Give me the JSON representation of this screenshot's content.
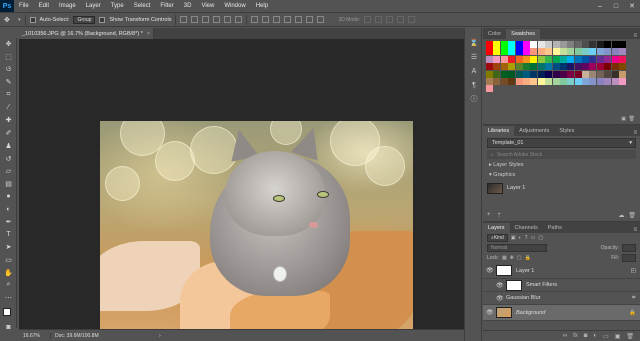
{
  "menubar": {
    "logo": "Ps",
    "items": [
      "File",
      "Edit",
      "Image",
      "Layer",
      "Type",
      "Select",
      "Filter",
      "3D",
      "View",
      "Window",
      "Help"
    ],
    "window_controls": [
      "–",
      "□",
      "✕"
    ]
  },
  "optbar": {
    "auto_select_label": "Auto-Select:",
    "auto_select_value": "Group",
    "show_transform_label": "Show Transform Controls",
    "mode_3d_label": "3D Mode:"
  },
  "document": {
    "tab_title": "_1010356.JPG @ 16.7% (Background, RGB/8*) *",
    "tab_close": "×"
  },
  "statusbar": {
    "zoom": "16.67%",
    "doc_size": "Doc: 39.6M/100.8M",
    "arrow": "›"
  },
  "swatches_panel": {
    "tabs": [
      "Color",
      "Swatches"
    ],
    "active_tab": "Swatches",
    "colors": [
      "#ff0000",
      "#ffff00",
      "#00ff00",
      "#00ffff",
      "#0000ff",
      "#ff00ff",
      "#ffffff",
      "#e6e6e6",
      "#cccccc",
      "#b3b3b3",
      "#999999",
      "#808080",
      "#666666",
      "#4d4d4d",
      "#333333",
      "#1a1a1a",
      "#000000",
      "#000000",
      "#000000",
      "#ff0000",
      "#ffff00",
      "#00ff00",
      "#00ffff",
      "#0000ff",
      "#ff00ff",
      "#f7977a",
      "#f9ad81",
      "#fdc68a",
      "#fff79a",
      "#c4df9b",
      "#a2d39c",
      "#82ca9d",
      "#7bcdc8",
      "#6ecff6",
      "#7ea7d8",
      "#8493ca",
      "#8882be",
      "#a187be",
      "#bc8dbf",
      "#f49ac2",
      "#f6989d",
      "#ed1c24",
      "#f26522",
      "#f7941d",
      "#fff200",
      "#8dc73f",
      "#39b54a",
      "#00a651",
      "#00a99d",
      "#00aeef",
      "#0072bc",
      "#0054a6",
      "#2e3192",
      "#662d91",
      "#92278f",
      "#ec008c",
      "#ed145b",
      "#9e0b0f",
      "#a0410d",
      "#a3620a",
      "#aba000",
      "#598527",
      "#1a7b30",
      "#007236",
      "#00746b",
      "#0076a3",
      "#004b80",
      "#003471",
      "#1b1464",
      "#440e62",
      "#630460",
      "#9e005d",
      "#9e0039",
      "#790000",
      "#7b2e00",
      "#7d4900",
      "#827b00",
      "#406618",
      "#005e20",
      "#005826",
      "#005952",
      "#005b7f",
      "#003663",
      "#002157",
      "#0d004c",
      "#32004b",
      "#4b0049",
      "#7b0046",
      "#7a0026",
      "#c7b299",
      "#998675",
      "#736357",
      "#534741",
      "#37302a",
      "#c69c6d",
      "#a67c52",
      "#8c6239",
      "#754c24",
      "#603913",
      "#f7977a",
      "#f9ad81",
      "#fdc68a",
      "#fff79a",
      "#c4df9b",
      "#a2d39c",
      "#82ca9d",
      "#7bcdc8",
      "#6ecff6",
      "#7ea7d8",
      "#8493ca",
      "#8882be",
      "#a187be",
      "#bc8dbf",
      "#f49ac2",
      "#f6989d"
    ]
  },
  "libraries_panel": {
    "tabs": [
      "Libraries",
      "Adjustments",
      "Styles"
    ],
    "active_tab": "Libraries",
    "library_name": "Template_01",
    "search_placeholder": "Search Adobe Stock",
    "section_layer_styles": "Layer Styles",
    "section_graphics": "Graphics",
    "graphic_item": "Layer 1"
  },
  "layers_panel": {
    "tabs": [
      "Layers",
      "Channels",
      "Paths"
    ],
    "active_tab": "Layers",
    "kind_filter": "Kind",
    "blend_mode": "Normal",
    "opacity_label": "Opacity:",
    "fill_label": "Fill:",
    "lock_label": "Lock:",
    "layers": [
      {
        "name": "Layer 1"
      },
      {
        "name": "Smart Filters"
      },
      {
        "name": "Gaussian Blur"
      },
      {
        "name": "Background"
      }
    ]
  }
}
